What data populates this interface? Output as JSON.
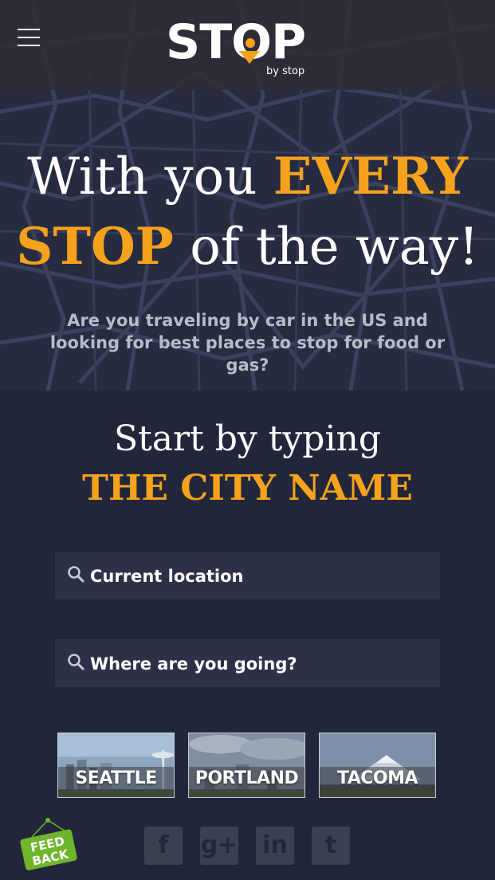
{
  "header": {
    "logo_text": "STOP",
    "logo_sub": "by stop",
    "menu_icon": "hamburger-icon"
  },
  "hero": {
    "headline_part1": "With you ",
    "headline_hl1": "EVERY",
    "headline_hl2": "STOP",
    "headline_part2": " of the way!",
    "lead": "Are you traveling by car in the US and looking for best places to stop for food or gas?"
  },
  "search": {
    "start_line": "Start by typing",
    "city_line": "THE CITY NAME",
    "from_placeholder": "Current location",
    "to_placeholder": "Where are you going?",
    "icon": "search-icon"
  },
  "cities": [
    {
      "label": "SEATTLE"
    },
    {
      "label": "PORTLAND"
    },
    {
      "label": "TACOMA"
    }
  ],
  "social": [
    {
      "name": "facebook-icon",
      "glyph": "f"
    },
    {
      "name": "google-plus-icon",
      "glyph": "g+"
    },
    {
      "name": "linkedin-icon",
      "glyph": "in"
    },
    {
      "name": "twitter-icon",
      "glyph": "t"
    }
  ],
  "feedback": {
    "line1": "FEED",
    "line2": "BACK"
  },
  "colors": {
    "accent": "#f6a21c",
    "background": "#22263a",
    "field": "#2c3147",
    "feedback": "#6fb52c"
  }
}
